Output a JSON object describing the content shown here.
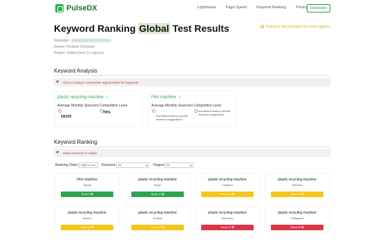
{
  "brand": {
    "name": "PulseDX"
  },
  "nav": {
    "links": [
      "Lighthouse",
      "Page Speed",
      "Keyword Ranking",
      "Pricing"
    ],
    "dashboard": "Dashboard"
  },
  "header": {
    "title_pre": "Keyword Ranking ",
    "title_hl": "Global",
    "title_post": " Test Results",
    "notice": "Testing is still scheduled for some regions."
  },
  "meta": {
    "webpage_label": "Webpage:",
    "device": "Device: Desktop Computer",
    "region": "Region: Global (total 31 regions)"
  },
  "analysis": {
    "title": "Keyword Analysis",
    "banner": "Click to analyze competitive opportunities for keywords",
    "cards": [
      {
        "keyword": "plastic recycling machine",
        "ams_label": "Average Monthly Searches",
        "ams_value": "18100",
        "comp_label": "Competition Level",
        "comp_value": "78%"
      },
      {
        "keyword": "Film machine",
        "ams_label": "Average Monthly Searches",
        "ams_value": "Insufficient data to provide keyword suggestions",
        "comp_label": "Competition Level",
        "comp_value": "Insufficient data to provide keyword suggestions"
      }
    ]
  },
  "ranking": {
    "title": "Keyword Ranking",
    "banner": "Select keyword or region",
    "order_label": "Ranking Order:",
    "order_value": "High to Low",
    "keyword_label": "Keyword:",
    "keyword_value": "All",
    "region_label": "Region:",
    "region_value": "All",
    "results": [
      {
        "keyword": "Film machine",
        "region": "Taiwan",
        "rank": "Rank 9",
        "color": "green"
      },
      {
        "keyword": "plastic recycling machine",
        "region": "Spain",
        "rank": "Rank 10",
        "color": "green"
      },
      {
        "keyword": "plastic recycling machine",
        "region": "Thailand",
        "rank": "Rank 14",
        "color": "yellow"
      },
      {
        "keyword": "plastic recycling machine",
        "region": "Vietnam",
        "rank": "Rank 14",
        "color": "yellow"
      },
      {
        "keyword": "plastic recycling machine",
        "region": "Mexico",
        "rank": "Rank 15",
        "color": "yellow"
      },
      {
        "keyword": "plastic recycling machine",
        "region": "Poland",
        "rank": "Rank 15",
        "color": "yellow"
      },
      {
        "keyword": "plastic recycling machine",
        "region": "Germany",
        "rank": "Rank 21",
        "color": "red"
      },
      {
        "keyword": "plastic recycling machine",
        "region": "Philippines",
        "rank": "Rank 28",
        "color": "red"
      }
    ]
  }
}
